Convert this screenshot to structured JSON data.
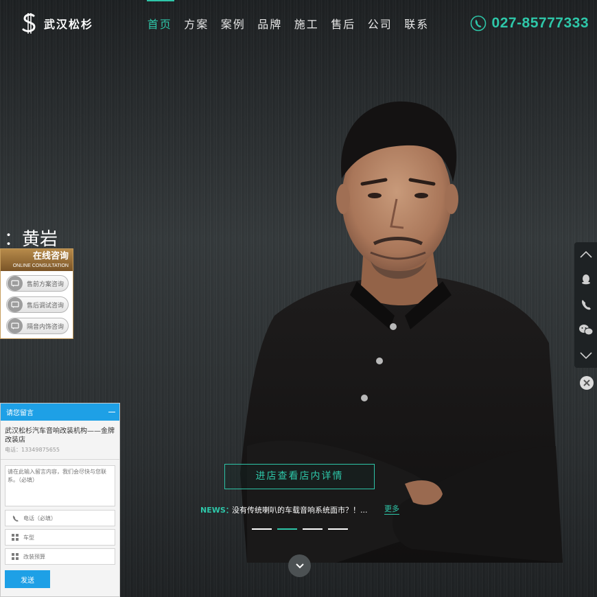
{
  "header": {
    "logo_text": "武汉松杉",
    "nav": [
      {
        "label": "首页",
        "active": true
      },
      {
        "label": "方案",
        "active": false
      },
      {
        "label": "案例",
        "active": false
      },
      {
        "label": "品牌",
        "active": false
      },
      {
        "label": "施工",
        "active": false
      },
      {
        "label": "售后",
        "active": false
      },
      {
        "label": "公司",
        "active": false
      },
      {
        "label": "联系",
        "active": false
      }
    ],
    "phone": "027-85777333"
  },
  "hero": {
    "caption": "：黄岩",
    "cta_label": "进店查看店内详情",
    "news_label": "NEWS：",
    "news_text": "没有传统喇叭的车载音响系统面市？！...",
    "news_more": "更多",
    "slides": 4,
    "active_slide": 1
  },
  "consult": {
    "title": "在线咨询",
    "subtitle": "ONLINE CONSULTATION",
    "items": [
      "售前方案咨询",
      "售后调试咨询",
      "隔音内饰咨询"
    ]
  },
  "message": {
    "title": "请您留言",
    "company": "武汉松杉汽车音响改装机构——金牌改装店",
    "contact": "电话：13349875655",
    "textarea_placeholder": "请在此输入留言内容，我们会尽快与您联系。（必填）",
    "phone_placeholder": "电话（必填）",
    "car_placeholder": "车型",
    "budget_placeholder": "改装预算",
    "send_label": "发送"
  },
  "colors": {
    "accent": "#2ec7a9",
    "message_blue": "#1ea0e6",
    "consult_gold": "#b68a4a"
  },
  "icons": {
    "float_bar": [
      "chevron-up-icon",
      "qq-icon",
      "phone-icon",
      "wechat-icon",
      "chevron-down-icon"
    ],
    "float_close": "close-icon",
    "scroll_down": "chevron-down-icon"
  }
}
